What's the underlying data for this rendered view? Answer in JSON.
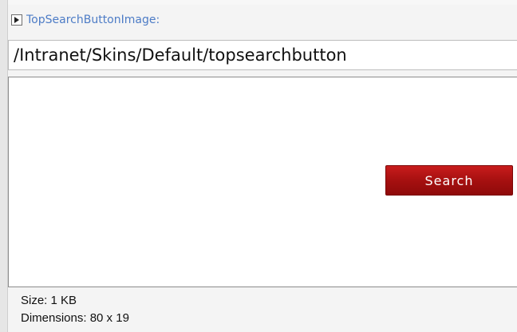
{
  "field": {
    "label": "TopSearchButtonImage:",
    "expand_icon": "expand-arrow-icon",
    "value": "/Intranet/Skins/Default/topsearchbutton"
  },
  "preview": {
    "button_text": "Search",
    "button_color": "#b01515"
  },
  "info": {
    "size_label": "Size:",
    "size_value": "1 KB",
    "dimensions_label": "Dimensions:",
    "dimensions_value": "80 x 19"
  },
  "colors": {
    "label": "#4d7cc6",
    "panel_background": "#f4f4f4"
  }
}
